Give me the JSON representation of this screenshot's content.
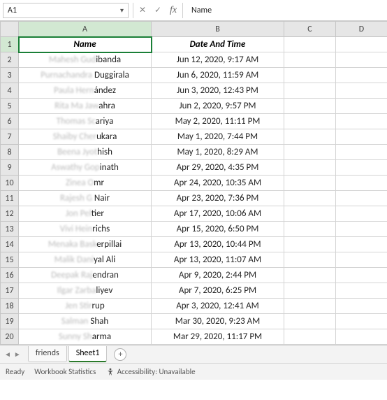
{
  "formula_bar": {
    "name_box": "A1",
    "formula": "Name"
  },
  "columns": [
    "A",
    "B",
    "C",
    "D"
  ],
  "header_row": {
    "name": "Name",
    "datetime": "Date And Time"
  },
  "rows": [
    {
      "n": 2,
      "name_blur": "Mahesh Gud",
      "name_clear": "ibanda",
      "datetime": "Jun 12, 2020, 9:17 AM"
    },
    {
      "n": 3,
      "name_blur": "Purnachandra ",
      "name_clear": "Duggirala",
      "datetime": "Jun 6, 2020, 11:59 AM"
    },
    {
      "n": 4,
      "name_blur": "Paula Hern",
      "name_clear": "ández",
      "datetime": "Jun 3, 2020, 12:43 PM"
    },
    {
      "n": 5,
      "name_blur": "Rita Ma Jaw",
      "name_clear": "ahra",
      "datetime": "Jun 2, 2020, 9:57 PM"
    },
    {
      "n": 6,
      "name_blur": "Thomas Sc",
      "name_clear": "ariya",
      "datetime": "May 2, 2020, 11:11 PM"
    },
    {
      "n": 7,
      "name_blur": "Shaiby Cher",
      "name_clear": "ukara",
      "datetime": "May 1, 2020, 7:44 PM"
    },
    {
      "n": 8,
      "name_blur": "Beena Jyot",
      "name_clear": "hish",
      "datetime": "May 1, 2020, 8:29 AM"
    },
    {
      "n": 9,
      "name_blur": "Aswathy Gop",
      "name_clear": "inath",
      "datetime": "Apr 29, 2020, 4:35 PM"
    },
    {
      "n": 10,
      "name_blur": "Zinea O",
      "name_clear": "mr",
      "datetime": "Apr 24, 2020, 10:35 AM"
    },
    {
      "n": 11,
      "name_blur": "Rajesh G ",
      "name_clear": "Nair",
      "datetime": "Apr 23, 2020, 7:36 PM"
    },
    {
      "n": 12,
      "name_blur": "Jon Pel",
      "name_clear": "tier",
      "datetime": "Apr 17, 2020, 10:06 AM"
    },
    {
      "n": 13,
      "name_blur": "Vivi Hein",
      "name_clear": "richs",
      "datetime": "Apr 15, 2020, 6:50 PM"
    },
    {
      "n": 14,
      "name_blur": "Menaka Bask",
      "name_clear": "erpillai",
      "datetime": "Apr 13, 2020, 10:44 PM"
    },
    {
      "n": 15,
      "name_blur": "Malik Dani",
      "name_clear": "yal Ali",
      "datetime": "Apr 13, 2020, 11:07 AM"
    },
    {
      "n": 16,
      "name_blur": "Deepak Raj",
      "name_clear": "endran",
      "datetime": "Apr 9, 2020, 2:44 PM"
    },
    {
      "n": 17,
      "name_blur": "Ilgar Zarba",
      "name_clear": "liyev",
      "datetime": "Apr 7, 2020, 6:25 PM"
    },
    {
      "n": 18,
      "name_blur": "Jen Stir",
      "name_clear": "rup",
      "datetime": "Apr 3, 2020, 12:41 AM"
    },
    {
      "n": 19,
      "name_blur": "Salman ",
      "name_clear": "Shah",
      "datetime": "Mar 30, 2020, 9:23 AM"
    },
    {
      "n": 20,
      "name_blur": "Sunny Sh",
      "name_clear": "arma",
      "datetime": "Mar 29, 2020, 11:17 PM"
    }
  ],
  "tabs": {
    "sheets": [
      "friends",
      "Sheet1"
    ],
    "active": "Sheet1"
  },
  "status": {
    "ready": "Ready",
    "stats": "Workbook Statistics",
    "accessibility": "Accessibility: Unavailable"
  }
}
